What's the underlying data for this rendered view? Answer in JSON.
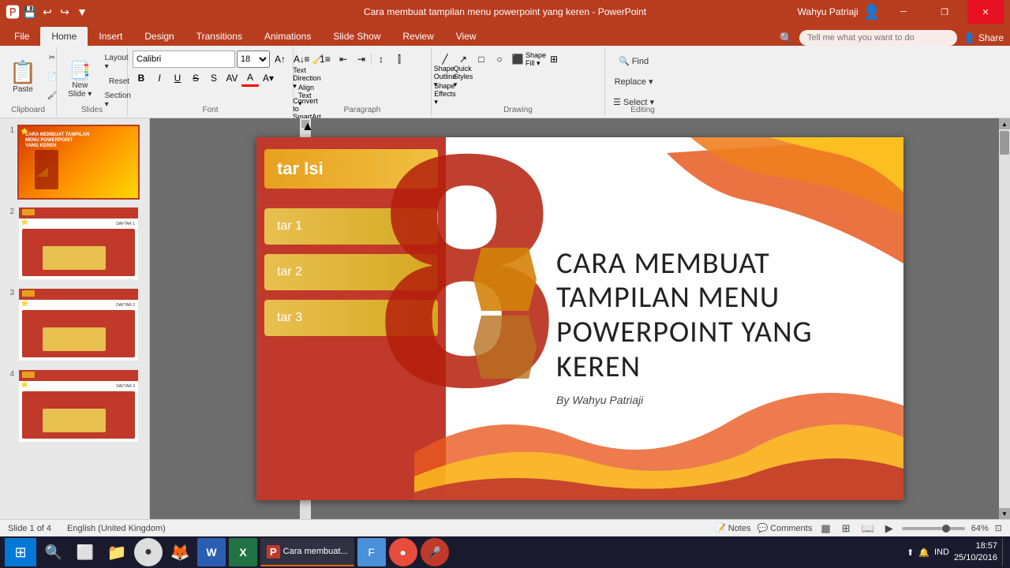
{
  "titlebar": {
    "title": "Cara membuat tampilan menu powerpoint yang keren - PowerPoint",
    "user": "Wahyu Patriaji",
    "save_icon": "💾",
    "undo_icon": "↩",
    "redo_icon": "↪",
    "customize_icon": "▼",
    "minimize": "─",
    "restore": "❐",
    "close": "✕"
  },
  "ribbon": {
    "tabs": [
      "File",
      "Home",
      "Insert",
      "Design",
      "Transitions",
      "Animations",
      "Slide Show",
      "Review",
      "View"
    ],
    "active_tab": "Home",
    "tell_me": "Tell me what you want to do",
    "share": "Share",
    "groups": {
      "clipboard": "Clipboard",
      "slides": "Slides",
      "font": "Font",
      "paragraph": "Paragraph",
      "drawing": "Drawing",
      "editing": "Editing"
    },
    "buttons": {
      "paste": "Paste",
      "cut": "Cut",
      "copy": "Copy",
      "format_painter": "Format Painter",
      "new_slide": "New Slide",
      "layout": "Layout",
      "reset": "Reset",
      "section": "Section",
      "bold": "B",
      "italic": "I",
      "underline": "U",
      "strikethrough": "S",
      "find": "Find",
      "replace": "Replace",
      "select": "Select",
      "shape_fill": "Shape Fill",
      "shape_outline": "Shape Outline",
      "shape_effects": "Shape Effects",
      "arrange": "Arrange",
      "quick_styles": "Quick Styles",
      "text_direction": "Text Direction",
      "align_text": "Align Text",
      "convert_smartart": "Convert to SmartArt",
      "bullets": "≡",
      "numbering": "≡#"
    },
    "font_name": "Calibri",
    "font_size": "18"
  },
  "slides": [
    {
      "num": "1",
      "active": true,
      "title": "CARA MEMBUAT TAMPILAN\nMENU POWERPOINT\nYANG KEREN"
    },
    {
      "num": "2",
      "active": false,
      "label": "DAFTAR 1"
    },
    {
      "num": "3",
      "active": false,
      "label": "DAFTAR 2"
    },
    {
      "num": "4",
      "active": false,
      "label": "DAFTAR 3"
    }
  ],
  "canvas": {
    "header_text": "tar Isi",
    "menu_items": [
      "tar 1",
      "tar 2",
      "tar 3"
    ],
    "title": "CARA MEMBUAT TAMPILAN MENU POWERPOINT YANG KEREN",
    "subtitle": "By Wahyu Patriaji"
  },
  "statusbar": {
    "slide_info": "Slide 1 of 4",
    "language": "English (United Kingdom)",
    "notes": "Notes",
    "comments": "Comments",
    "zoom": "64%"
  },
  "taskbar": {
    "apps": [
      {
        "icon": "🪟",
        "name": "Start",
        "type": "start"
      },
      {
        "icon": "🔍",
        "name": "Search"
      },
      {
        "icon": "📋",
        "name": "Task View"
      },
      {
        "icon": "📁",
        "name": "File Explorer"
      },
      {
        "icon": "🌐",
        "name": "Chrome"
      },
      {
        "icon": "🦊",
        "name": "Firefox"
      },
      {
        "icon": "W",
        "name": "Word"
      },
      {
        "icon": "X",
        "name": "Excel"
      },
      {
        "icon": "P",
        "name": "PowerPoint"
      },
      {
        "icon": "F",
        "name": "App1"
      },
      {
        "icon": "S",
        "name": "App2"
      },
      {
        "icon": "R",
        "name": "App3"
      }
    ],
    "time": "18:57",
    "date": "25/10/2016",
    "language": "IND"
  }
}
